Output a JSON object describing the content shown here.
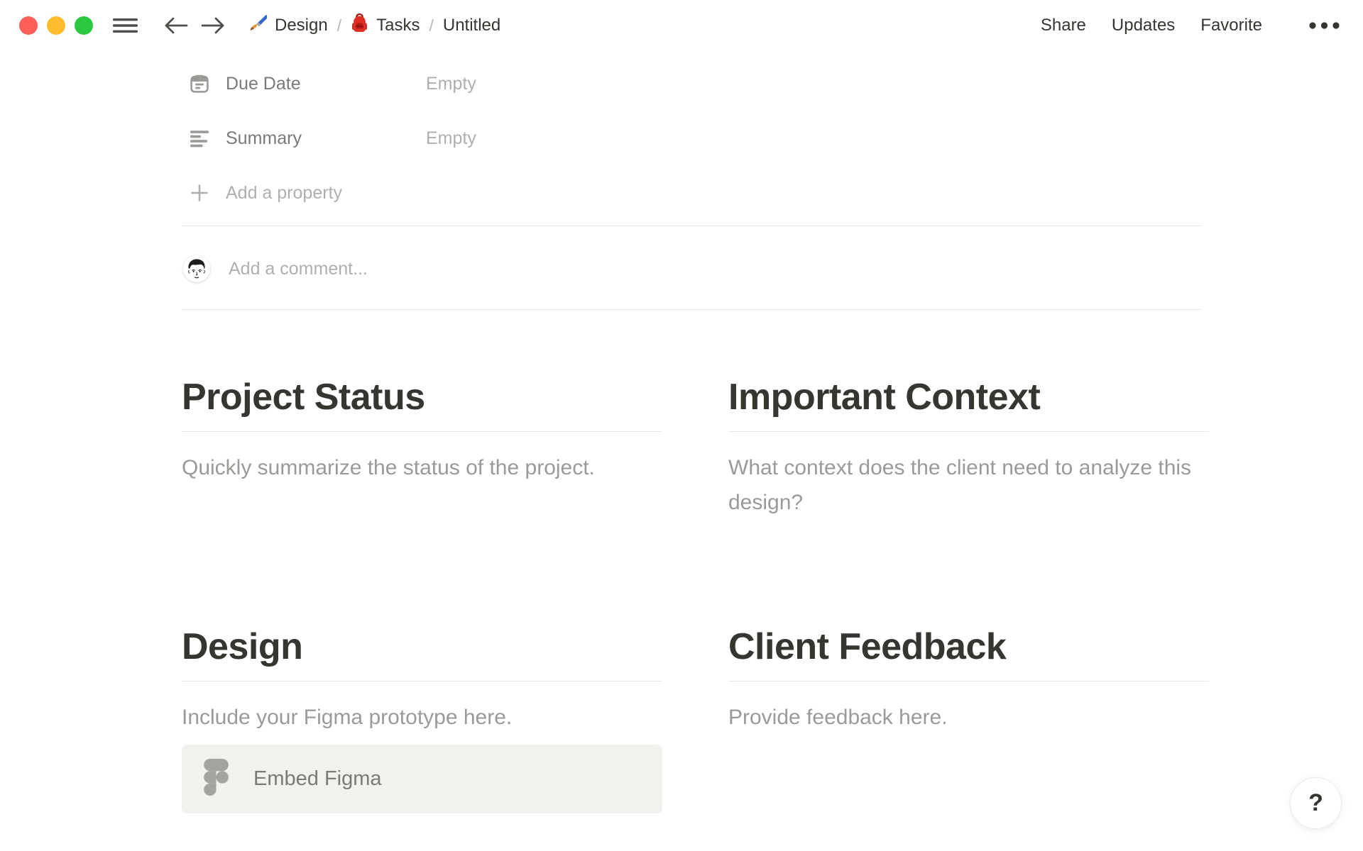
{
  "topbar": {
    "separator": "/",
    "breadcrumb": {
      "item1": {
        "label": "Design"
      },
      "item2": {
        "label": "Tasks"
      },
      "item3": {
        "label": "Untitled"
      }
    },
    "actions": {
      "share": "Share",
      "updates": "Updates",
      "favorite": "Favorite"
    }
  },
  "properties": {
    "rows": [
      {
        "icon": "calendar-icon",
        "label": "Due Date",
        "value": "Empty"
      },
      {
        "icon": "text-lines-icon",
        "label": "Summary",
        "value": "Empty"
      }
    ],
    "add_label": "Add a property"
  },
  "comment": {
    "placeholder": "Add a comment..."
  },
  "sections": [
    {
      "title": "Project Status",
      "body": "Quickly summarize the status of the project."
    },
    {
      "title": "Important Context",
      "body": "What context does the client need to analyze this design?"
    },
    {
      "title": "Design",
      "body": "Include your Figma prototype here.",
      "embed_label": "Embed Figma"
    },
    {
      "title": "Client Feedback",
      "body": "Provide feedback here."
    }
  ],
  "help": {
    "label": "?"
  },
  "colors": {
    "text_dark": "#37352f",
    "text_label": "#7b7a76",
    "text_placeholder": "#b1afac",
    "text_body": "#9b9a97",
    "divider": "#e9e8e5",
    "embed_background": "#f2f1ee",
    "traffic_red": "#ff5f57",
    "traffic_yellow": "#febc2e",
    "traffic_green": "#2bc840"
  }
}
